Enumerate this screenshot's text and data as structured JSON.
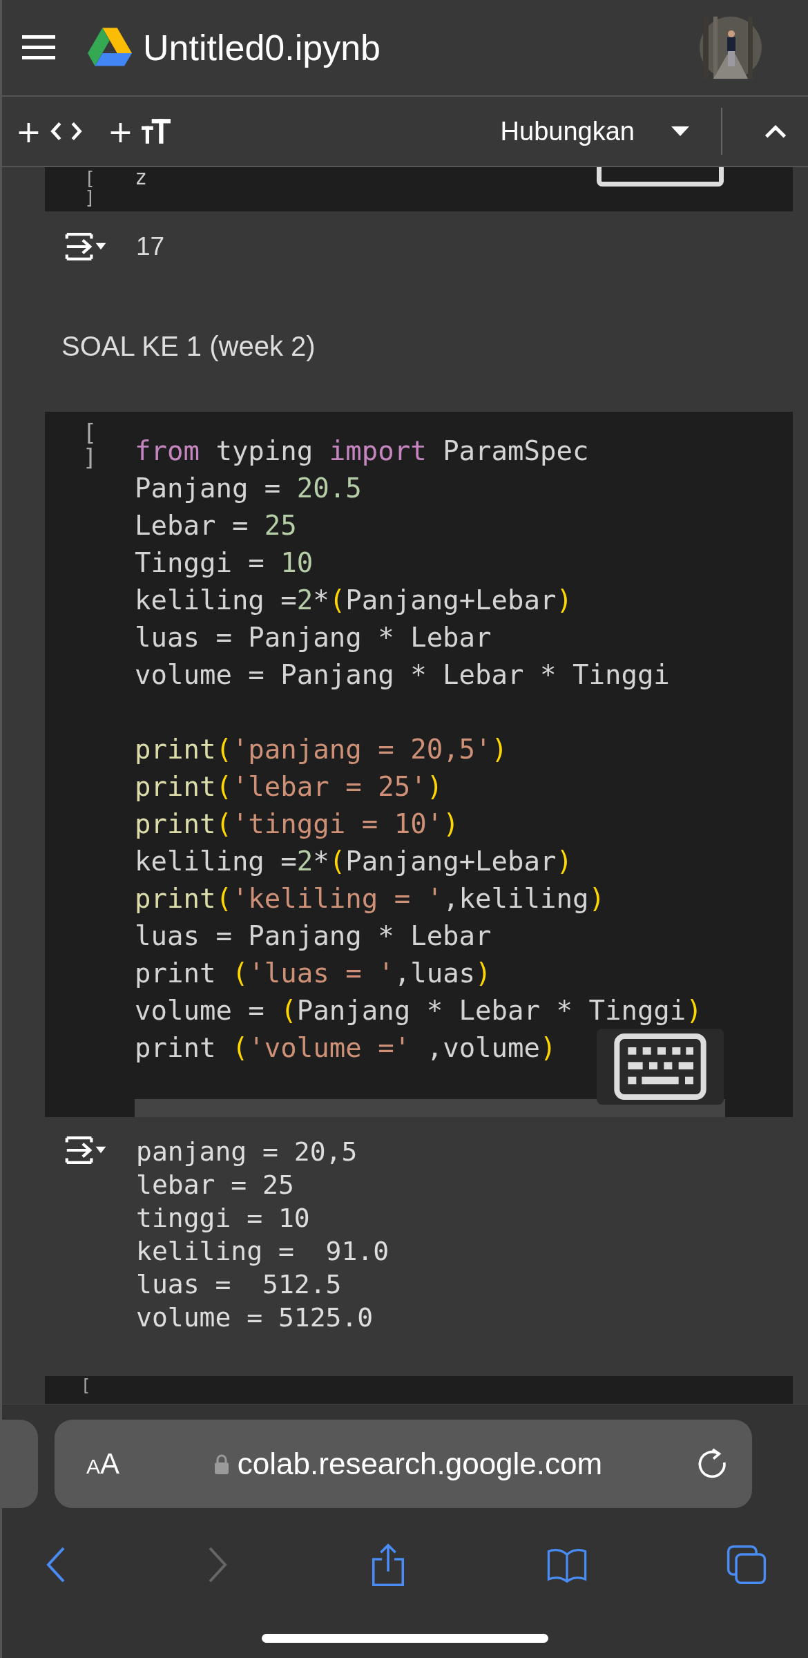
{
  "header": {
    "title": "Untitled0.ipynb"
  },
  "toolbar": {
    "add_code": {
      "plus": "+"
    },
    "add_text": {
      "plus": "+"
    },
    "connect": "Hubungkan"
  },
  "cells": [
    {
      "kind": "code_partial",
      "bracket_open": "[",
      "bracket_close": "]",
      "code": "z"
    },
    {
      "kind": "output",
      "text": "17"
    },
    {
      "kind": "text",
      "text": "SOAL KE 1 (week 2)"
    },
    {
      "kind": "code",
      "bracket_open": "[",
      "bracket_close": "]",
      "blocks": [
        [
          [
            {
              "kind": "keyword",
              "text": "from"
            },
            {
              "kind": "plain",
              "text": " typing "
            },
            {
              "kind": "keyword",
              "text": "import"
            },
            {
              "kind": "plain",
              "text": " ParamSpec"
            }
          ],
          [
            {
              "kind": "plain",
              "text": "Panjang = "
            },
            {
              "kind": "number",
              "text": "20.5"
            }
          ],
          [
            {
              "kind": "plain",
              "text": "Lebar = "
            },
            {
              "kind": "number",
              "text": "25"
            }
          ],
          [
            {
              "kind": "plain",
              "text": "Tinggi = "
            },
            {
              "kind": "number",
              "text": "10"
            }
          ],
          [
            {
              "kind": "plain",
              "text": "keliling ="
            },
            {
              "kind": "number",
              "text": "2"
            },
            {
              "kind": "plain",
              "text": "*"
            },
            {
              "kind": "paren",
              "text": "("
            },
            {
              "kind": "plain",
              "text": "Panjang+Lebar"
            },
            {
              "kind": "paren",
              "text": ")"
            }
          ],
          [
            {
              "kind": "plain",
              "text": "luas = Panjang * Lebar"
            }
          ],
          [
            {
              "kind": "plain",
              "text": "volume = Panjang * Lebar * Tinggi"
            }
          ]
        ],
        [
          [
            {
              "kind": "function",
              "text": "print"
            },
            {
              "kind": "paren",
              "text": "("
            },
            {
              "kind": "string",
              "text": "'panjang = 20,5'"
            },
            {
              "kind": "paren",
              "text": ")"
            }
          ],
          [
            {
              "kind": "function",
              "text": "print"
            },
            {
              "kind": "paren",
              "text": "("
            },
            {
              "kind": "string",
              "text": "'lebar = 25'"
            },
            {
              "kind": "paren",
              "text": ")"
            }
          ],
          [
            {
              "kind": "function",
              "text": "print"
            },
            {
              "kind": "paren",
              "text": "("
            },
            {
              "kind": "string",
              "text": "'tinggi = 10'"
            },
            {
              "kind": "paren",
              "text": ")"
            }
          ],
          [
            {
              "kind": "plain",
              "text": "keliling ="
            },
            {
              "kind": "number",
              "text": "2"
            },
            {
              "kind": "plain",
              "text": "*"
            },
            {
              "kind": "paren",
              "text": "("
            },
            {
              "kind": "plain",
              "text": "Panjang+Lebar"
            },
            {
              "kind": "paren",
              "text": ")"
            }
          ],
          [
            {
              "kind": "function",
              "text": "print"
            },
            {
              "kind": "paren",
              "text": "("
            },
            {
              "kind": "string",
              "text": "'keliling = '"
            },
            {
              "kind": "plain",
              "text": ",keliling"
            },
            {
              "kind": "paren",
              "text": ")"
            }
          ],
          [
            {
              "kind": "plain",
              "text": "luas = Panjang * Lebar"
            }
          ],
          [
            {
              "kind": "plain",
              "text": "print "
            },
            {
              "kind": "paren",
              "text": "("
            },
            {
              "kind": "string",
              "text": "'luas = '"
            },
            {
              "kind": "plain",
              "text": ",luas"
            },
            {
              "kind": "paren",
              "text": ")"
            }
          ],
          [
            {
              "kind": "plain",
              "text": "volume = "
            },
            {
              "kind": "paren",
              "text": "("
            },
            {
              "kind": "plain",
              "text": "Panjang * Lebar * Tinggi"
            },
            {
              "kind": "paren",
              "text": ")"
            }
          ],
          [
            {
              "kind": "plain",
              "text": "print "
            },
            {
              "kind": "paren",
              "text": "("
            },
            {
              "kind": "string",
              "text": "'volume ='"
            },
            {
              "kind": "plain",
              "text": " ,volume"
            },
            {
              "kind": "paren",
              "text": ")"
            }
          ]
        ]
      ]
    },
    {
      "kind": "output_lines",
      "lines": [
        "panjang = 20,5",
        "lebar = 25",
        "tinggi = 10",
        "keliling =  91.0",
        "luas =  512.5",
        "volume = 5125.0"
      ]
    },
    {
      "kind": "code_stub",
      "bracket_open": "["
    }
  ],
  "browser": {
    "reader_small": "A",
    "reader_large": "A",
    "url": "colab.research.google.com"
  }
}
